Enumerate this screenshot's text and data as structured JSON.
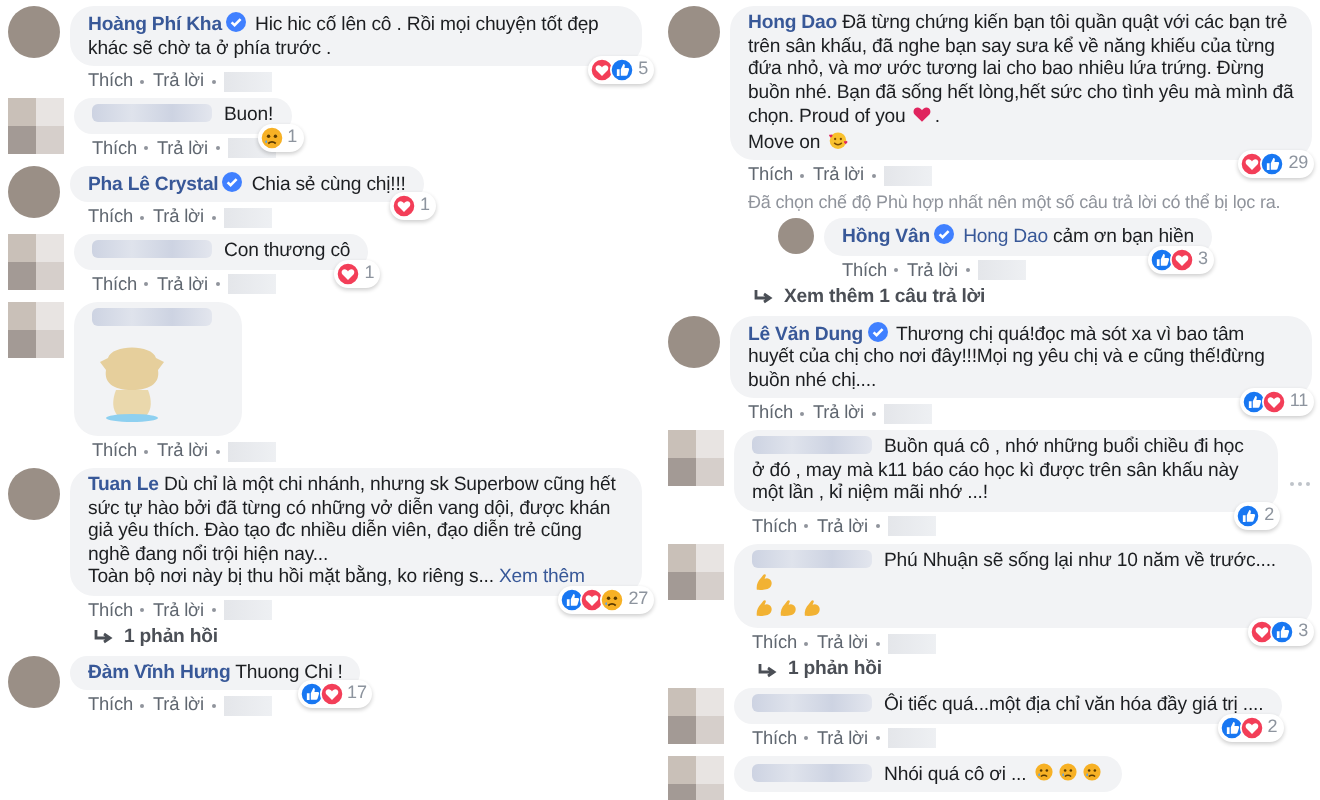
{
  "columns": [
    {
      "comments": [
        {
          "kind": "named",
          "name": "Hoàng Phí Kha",
          "verified": true,
          "parts": [
            {
              "kind": "text",
              "text": "Hic hic cố lên cô . Rồi mọi chuyện tốt đẹp khác sẽ chờ ta ở phía trước ."
            }
          ],
          "reactions": [
            {
              "kind": "love"
            },
            {
              "kind": "like"
            }
          ],
          "reaction_count": "5",
          "actions": [
            "Thích",
            "Trả lời"
          ]
        },
        {
          "kind": "anonymous",
          "parts": [
            {
              "kind": "text",
              "text": "Buon!"
            }
          ],
          "reactions": [
            {
              "kind": "sad"
            }
          ],
          "reaction_count": "1",
          "actions": [
            "Thích",
            "Trả lời"
          ]
        },
        {
          "kind": "named",
          "name": "Pha Lê Crystal",
          "verified": true,
          "parts": [
            {
              "kind": "text",
              "text": "Chia sẻ cùng chị!!!"
            }
          ],
          "reactions": [
            {
              "kind": "love"
            }
          ],
          "reaction_count": "1",
          "actions": [
            "Thích",
            "Trả lời"
          ]
        },
        {
          "kind": "anonymous",
          "parts": [
            {
              "kind": "text",
              "text": "Con thương cô"
            }
          ],
          "reactions": [
            {
              "kind": "love"
            }
          ],
          "reaction_count": "1",
          "actions": [
            "Thích",
            "Trả lời"
          ]
        },
        {
          "kind": "anonymous",
          "sticker": true,
          "actions": [
            "Thích",
            "Trả lời"
          ]
        },
        {
          "kind": "named",
          "name": "Tuan Le",
          "parts": [
            {
              "kind": "text",
              "text": "Dù chỉ là một chi nhánh, nhưng sk Superbow cũng hết sức tự hào bởi đã từng có những vở diễn vang dội, được khán giả yêu thích. Đào tạo đc nhiều diễn viên, đạo diễn trẻ cũng nghề đang nổi trội hiện nay..."
            },
            {
              "kind": "break"
            },
            {
              "kind": "text",
              "text": "Toàn bộ nơi này bị thu hồi mặt bằng, ko riêng s..."
            },
            {
              "kind": "link",
              "text": "Xem thêm"
            }
          ],
          "reactions": [
            {
              "kind": "like"
            },
            {
              "kind": "love"
            },
            {
              "kind": "sad"
            }
          ],
          "reaction_count": "27",
          "actions": [
            "Thích",
            "Trả lời"
          ],
          "replies_link": "1 phản hồi"
        },
        {
          "kind": "named",
          "name": "Đàm Vĩnh Hưng",
          "parts": [
            {
              "kind": "text",
              "text": "Thuong Chi !"
            }
          ],
          "reactions": [
            {
              "kind": "like"
            },
            {
              "kind": "love"
            }
          ],
          "reaction_count": "17",
          "actions": [
            "Thích",
            "Trả lời"
          ]
        }
      ]
    },
    {
      "comments": [
        {
          "kind": "named",
          "name": "Hong Dao",
          "parts": [
            {
              "kind": "text",
              "text": "Đã từng chứng kiến bạn tôi quần quật với các bạn trẻ trên sân khấu, đã nghe bạn say sưa kể về năng khiếu của từng đứa nhỏ, và mơ ước tương lai cho bao nhiêu lứa trứng. Đừng buồn nhé. Bạn đã sống hết lòng,hết sức cho tình yêu mà mình đã chọn. Proud of you"
            },
            {
              "kind": "heart"
            },
            {
              "kind": "text",
              "text": "."
            },
            {
              "kind": "break"
            },
            {
              "kind": "text",
              "text": "Move on"
            },
            {
              "kind": "love-face"
            }
          ],
          "reactions": [
            {
              "kind": "love"
            },
            {
              "kind": "like"
            }
          ],
          "reaction_count": "29",
          "actions": [
            "Thích",
            "Trả lời"
          ],
          "notice": "Đã chọn chế độ Phù hợp nhất nên một số câu trả lời có thể bị lọc ra.",
          "reply": {
            "kind": "named",
            "name": "Hồng Vân",
            "verified": true,
            "parts": [
              {
                "kind": "mention",
                "text": "Hong Dao"
              },
              {
                "kind": "text",
                "text": "cảm ơn bạn hiền"
              }
            ],
            "reactions": [
              {
                "kind": "like"
              },
              {
                "kind": "love"
              }
            ],
            "reaction_count": "3",
            "actions": [
              "Thích",
              "Trả lời"
            ]
          },
          "more_replies": "Xem thêm 1 câu trả lời"
        },
        {
          "kind": "named",
          "name": "Lê Văn Dung",
          "verified": true,
          "parts": [
            {
              "kind": "text",
              "text": "Thương chị quá!đọc mà sót xa vì bao tâm huyết của chị cho nơi đây!!!Mọi ng yêu chị và e cũng thế!đừng buồn nhé chị...."
            }
          ],
          "reactions": [
            {
              "kind": "like"
            },
            {
              "kind": "love"
            }
          ],
          "reaction_count": "11",
          "actions": [
            "Thích",
            "Trả lời"
          ]
        },
        {
          "kind": "anonymous",
          "parts": [
            {
              "kind": "text",
              "text": "Buồn quá cô , nhớ những buổi chiều đi học ở đó , may mà k11 báo cáo học kì được trên sân khấu này một lần , kỉ niệm mãi nhớ ...!"
            }
          ],
          "reactions": [
            {
              "kind": "like"
            }
          ],
          "reaction_count": "2",
          "actions": [
            "Thích",
            "Trả lời"
          ],
          "options": true
        },
        {
          "kind": "anonymous",
          "parts": [
            {
              "kind": "text",
              "text": "Phú Nhuận sẽ sống lại như 10 năm về trước...."
            },
            {
              "kind": "muscle"
            },
            {
              "kind": "break"
            },
            {
              "kind": "muscle"
            },
            {
              "kind": "muscle"
            },
            {
              "kind": "muscle"
            }
          ],
          "reactions": [
            {
              "kind": "love"
            },
            {
              "kind": "like"
            }
          ],
          "reaction_count": "3",
          "actions": [
            "Thích",
            "Trả lời"
          ],
          "replies_link": "1 phản hồi"
        },
        {
          "kind": "anonymous",
          "parts": [
            {
              "kind": "text",
              "text": "Ôi tiếc quá...một địa chỉ văn hóa đầy giá trị ...."
            }
          ],
          "reactions": [
            {
              "kind": "like"
            },
            {
              "kind": "love"
            }
          ],
          "reaction_count": "2",
          "actions": [
            "Thích",
            "Trả lời"
          ]
        },
        {
          "kind": "anonymous",
          "parts": [
            {
              "kind": "text",
              "text": "Nhói quá cô ơi ..."
            },
            {
              "kind": "sad"
            },
            {
              "kind": "sad"
            },
            {
              "kind": "sad"
            }
          ]
        }
      ]
    }
  ]
}
